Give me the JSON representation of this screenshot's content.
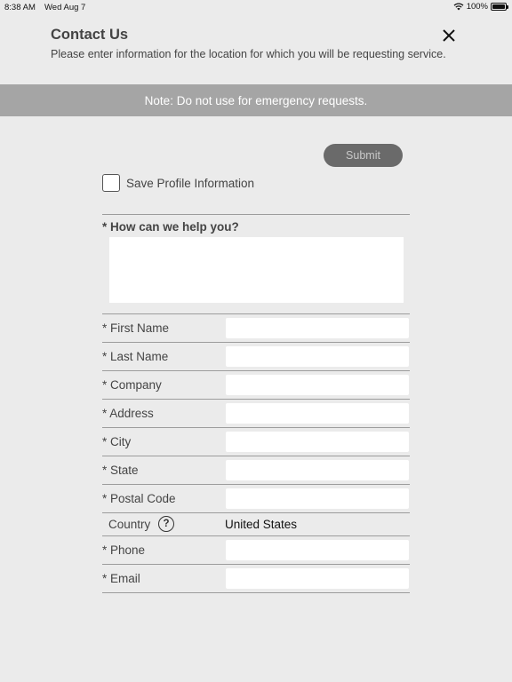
{
  "status_bar": {
    "time": "8:38 AM",
    "date": "Wed Aug 7",
    "battery": "100%"
  },
  "header": {
    "title": "Contact Us",
    "subtitle": "Please enter information for the location for which you will be requesting service."
  },
  "note": "Note: Do not use for emergency requests.",
  "submit_label": "Submit",
  "save_profile_label": "Save Profile Information",
  "help_label": "* How can we help you?",
  "fields": {
    "first_name": "* First Name",
    "last_name": "* Last Name",
    "company": "* Company",
    "address": "* Address",
    "city": "* City",
    "state": "* State",
    "postal_code": "* Postal Code",
    "phone": "* Phone",
    "email": "* Email"
  },
  "country": {
    "label": "Country",
    "help_symbol": "?",
    "value": "United States"
  },
  "icons": [
    "wifi-icon",
    "battery-icon",
    "close-icon",
    "help-icon"
  ]
}
